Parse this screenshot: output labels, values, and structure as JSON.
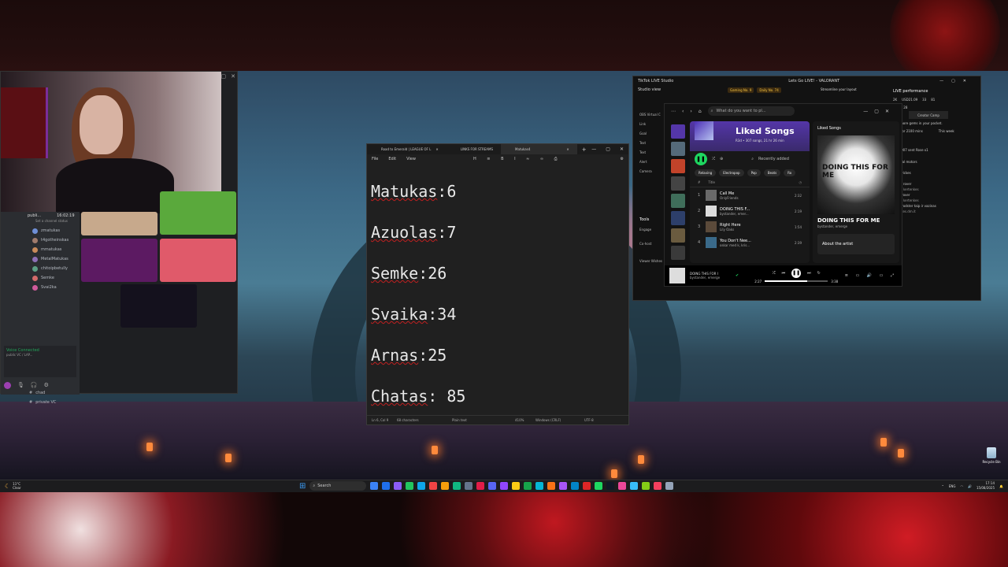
{
  "notepad": {
    "tabs": [
      "Road to Emerald | LEAGUE OF L",
      "LINKS FOR STREAMS",
      "Matukas4"
    ],
    "menu": [
      "File",
      "Edit",
      "View"
    ],
    "lines": [
      {
        "name": "Matukas",
        "sep": ":",
        "value": "6"
      },
      {
        "name": "Azuolas",
        "sep": ":",
        "value": "7"
      },
      {
        "name": "Semke",
        "sep": ":",
        "value": "26"
      },
      {
        "name": "Svaika",
        "sep": ":",
        "value": "34"
      },
      {
        "name": "Arnas",
        "sep": ":",
        "value": "25"
      },
      {
        "name": "Chatas",
        "sep": ": ",
        "value": "85"
      }
    ],
    "status": {
      "position": "Ln 6, Col 9",
      "chars": "68 characters",
      "format": "Plain text",
      "zoom": "410%",
      "eol": "Windows (CRLF)",
      "encoding": "UTF-8"
    }
  },
  "discord": {
    "header": {
      "name": "publi...",
      "time": "16:02:19",
      "status": "Set a channel status"
    },
    "members": [
      "zmatukas",
      "t4gotheinskas",
      "mmatukas",
      "MetalMatukas",
      "chitoipbetully",
      "Semke",
      "Svai2ka"
    ],
    "channels": [
      "chad",
      "private VC"
    ],
    "voice": {
      "title": "Voice Connected",
      "sub": "public VC / LAP..."
    }
  },
  "tiktok": {
    "title": "TikTok LIVE Studio",
    "center_title": "Lets Go LIVE! - VALORANT",
    "studio_view": "Studio view",
    "badges": [
      "Gaming No. 9",
      "Daily No. 74"
    ],
    "streamline": "Streamline your layout",
    "left_items": [
      "OBS Virtual C",
      "Link",
      "Goal",
      "Text",
      "Text",
      "Alert",
      "Camera",
      "Tools",
      "Engage",
      "Co-host",
      "Viewer Wishes"
    ],
    "right": {
      "header": "LIVE performance",
      "stat_a": "2K",
      "money": "USD21.09",
      "stat_b": "33",
      "stat_c": "81",
      "stat_d": ".2M",
      "stat_e": "28",
      "creator_camp": "Creator Camp",
      "promo": "220 more gems in your pocket.",
      "live_for": "LIVE for 2100 mins",
      "this_week": "This week",
      "chat_title": "chat",
      "chat": [
        "Rond007 sent Rose x1",
        "Deny",
        "general motors",
        "Rave",
        "Moskvickes",
        "Deyu",
        "range rover",
        "Vaijus kertenkes",
        "Land rover",
        "Vaijus kertenkes",
        "Tesla rodster taip ir vazinas",
        "Valyutes.dm.it",
        "Tesla"
      ]
    }
  },
  "spotify": {
    "search_placeholder": "What do you want to pl...",
    "playlist_title": "Liked Songs",
    "playlist_sub": "R3d • 307 songs, 21 hr 26 min",
    "sort_label": "Recently added",
    "chips": [
      "Relaxing",
      "Electropop",
      "Pop",
      "Beats",
      "Ro"
    ],
    "col_title": "Title",
    "tracks": [
      {
        "num": "1",
        "title": "Call Me",
        "artist": "OnlyFriends",
        "dur": "2:32"
      },
      {
        "num": "2",
        "title": "DOING THIS F...",
        "artist": "bystander, emer...",
        "dur": "2:19"
      },
      {
        "num": "3",
        "title": "Right Here",
        "artist": "Lily Oaks",
        "dur": "1:54"
      },
      {
        "num": "4",
        "title": "You Don't Nee...",
        "artist": "oskar med k, kris...",
        "dur": "2:39"
      }
    ],
    "now_label": "Liked Songs",
    "art_text": "DOING THIS FOR ME",
    "now_title": "DOING THIS FOR ME",
    "now_artist": "bystander, emerge",
    "about": "About the artist",
    "player": {
      "title": "DOING THIS FOR I",
      "artist": "bystander, emerge",
      "elapsed": "2:27",
      "total": "3:38",
      "progress": 0.67
    }
  },
  "taskbar": {
    "temp": "11°C",
    "cond": "Clear",
    "search": "Search",
    "lang": "ENG",
    "time": "17:14",
    "date": "15/08/2025",
    "app_colors": [
      "#3b82f6",
      "#1f6feb",
      "#8b5cf6",
      "#22c55e",
      "#0ea5e9",
      "#ef4444",
      "#f59e0b",
      "#10b981",
      "#64748b",
      "#e11d48",
      "#5865f2",
      "#9146ff",
      "#facc15",
      "#16a34a",
      "#06b6d4",
      "#f97316",
      "#a855f7",
      "#0284c7",
      "#dc2626",
      "#1ed760",
      "#111827",
      "#ec4899",
      "#38bdf8",
      "#84cc16",
      "#f43f5e",
      "#94a3b8"
    ]
  },
  "recycle_bin": "Recycle Bin"
}
